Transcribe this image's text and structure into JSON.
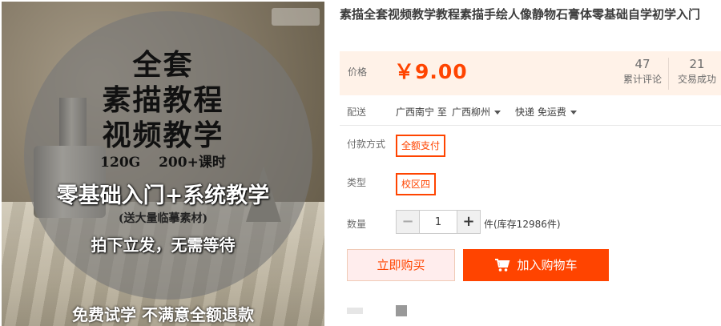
{
  "product_image": {
    "lines": [
      "全套",
      "素描教程",
      "视频教学",
      "120G　 200+课时",
      "零基础入门+系统教学",
      "(送大量临摹素材)",
      "拍下立发，无需等待",
      "免费试学 不满意全额退款"
    ]
  },
  "title": "素描全套视频教学教程素描手绘人像静物石膏体零基础自学初学入门",
  "price": {
    "label": "价格",
    "value": "￥9.00",
    "reviews_count": "47",
    "reviews_label": "累计评论",
    "sales_count": "21",
    "sales_label": "交易成功",
    "color": "#ff4400"
  },
  "shipping": {
    "label": "配送",
    "from": "广西南宁 至",
    "to": "广西柳州",
    "method": "快递 免运费"
  },
  "payment": {
    "label": "付款方式",
    "option": "全额支付"
  },
  "type": {
    "label": "类型",
    "option": "校区四"
  },
  "quantity": {
    "label": "数量",
    "value": "1",
    "stock": "件(库存12986件)"
  },
  "actions": {
    "buy_now": "立即购买",
    "add_to_cart": "加入购物车",
    "accent": "#ff4400"
  },
  "icons": [
    "minus-icon",
    "plus-icon",
    "cart-icon",
    "caret-down-icon"
  ]
}
